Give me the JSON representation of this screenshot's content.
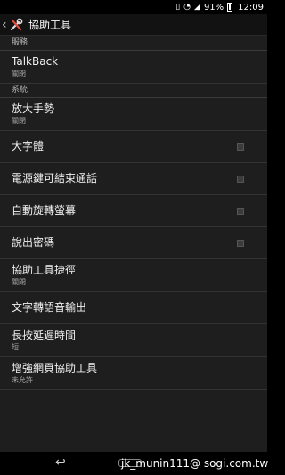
{
  "status": {
    "battery": "91%",
    "time": "12:09"
  },
  "actionbar": {
    "title": "協助工具"
  },
  "sections": {
    "services": {
      "header": "服務"
    },
    "system": {
      "header": "系統"
    }
  },
  "items": {
    "talkback": {
      "title": "TalkBack",
      "summary": "關閉"
    },
    "magnify": {
      "title": "放大手勢",
      "summary": "關閉"
    },
    "large_text": {
      "title": "大字體"
    },
    "power_end_call": {
      "title": "電源鍵可結束通話"
    },
    "auto_rotate": {
      "title": "自動旋轉螢幕"
    },
    "speak_password": {
      "title": "說出密碼"
    },
    "shortcut": {
      "title": "協助工具捷徑",
      "summary": "關閉"
    },
    "tts": {
      "title": "文字轉語音輸出"
    },
    "long_press": {
      "title": "長按延遲時間",
      "summary": "短"
    },
    "web_access": {
      "title": "增強網頁協助工具",
      "summary": "未允許"
    }
  },
  "watermark": "jk_munin111@ sogi.com.tw"
}
